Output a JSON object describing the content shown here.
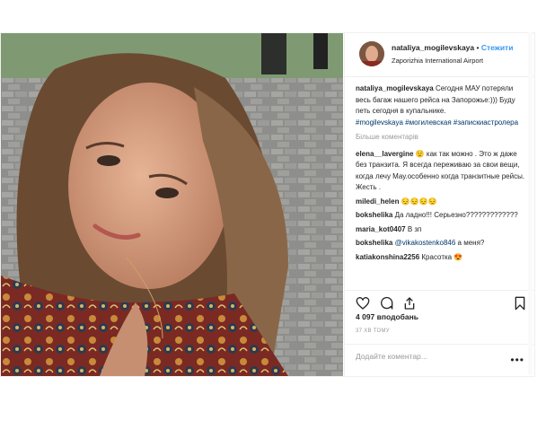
{
  "header": {
    "username": "nataliya_mogilevskaya",
    "separator": "•",
    "follow_label": "Стежити",
    "location": "Zaporizhia International Airport"
  },
  "caption": {
    "username": "nataliya_mogilevskaya",
    "text": "Сегодня МАУ потеряли весь багаж нашего рейса на Запорожье:))) Буду петь сегодня в купальнике.",
    "hashtags": "#mogilevskaya #могилевская #записки­астролера"
  },
  "more_comments_label": "Більше коментарів",
  "comments": [
    {
      "user": "elena__lavergine",
      "text": "😟 как так можно . Это ж даже без транзита. Я всегда переживаю за свои вещи, когда лечу Мау.особенно когда транзитные рейсы. Жесть ."
    },
    {
      "user": "miledi_helen",
      "text": "😔😔😔😔"
    },
    {
      "user": "bokshelika",
      "text": "Да ладно!!! Серьезно?????????????"
    },
    {
      "user": "maria_kot0407",
      "text": "В зп"
    },
    {
      "user": "bokshelika",
      "mention": "@vikakostenko846",
      "text": "а меня?"
    },
    {
      "user": "katiakonshina2256",
      "text": "Красотка 😍"
    }
  ],
  "likes": "4 097 вподобань",
  "time_ago": "37 хв тому",
  "add_comment_placeholder": "Додайте коментар...",
  "menu_dots": "•••",
  "colors": {
    "accent": "#3897f0",
    "hashtag": "#003569",
    "muted": "#999999",
    "text": "#262626"
  }
}
